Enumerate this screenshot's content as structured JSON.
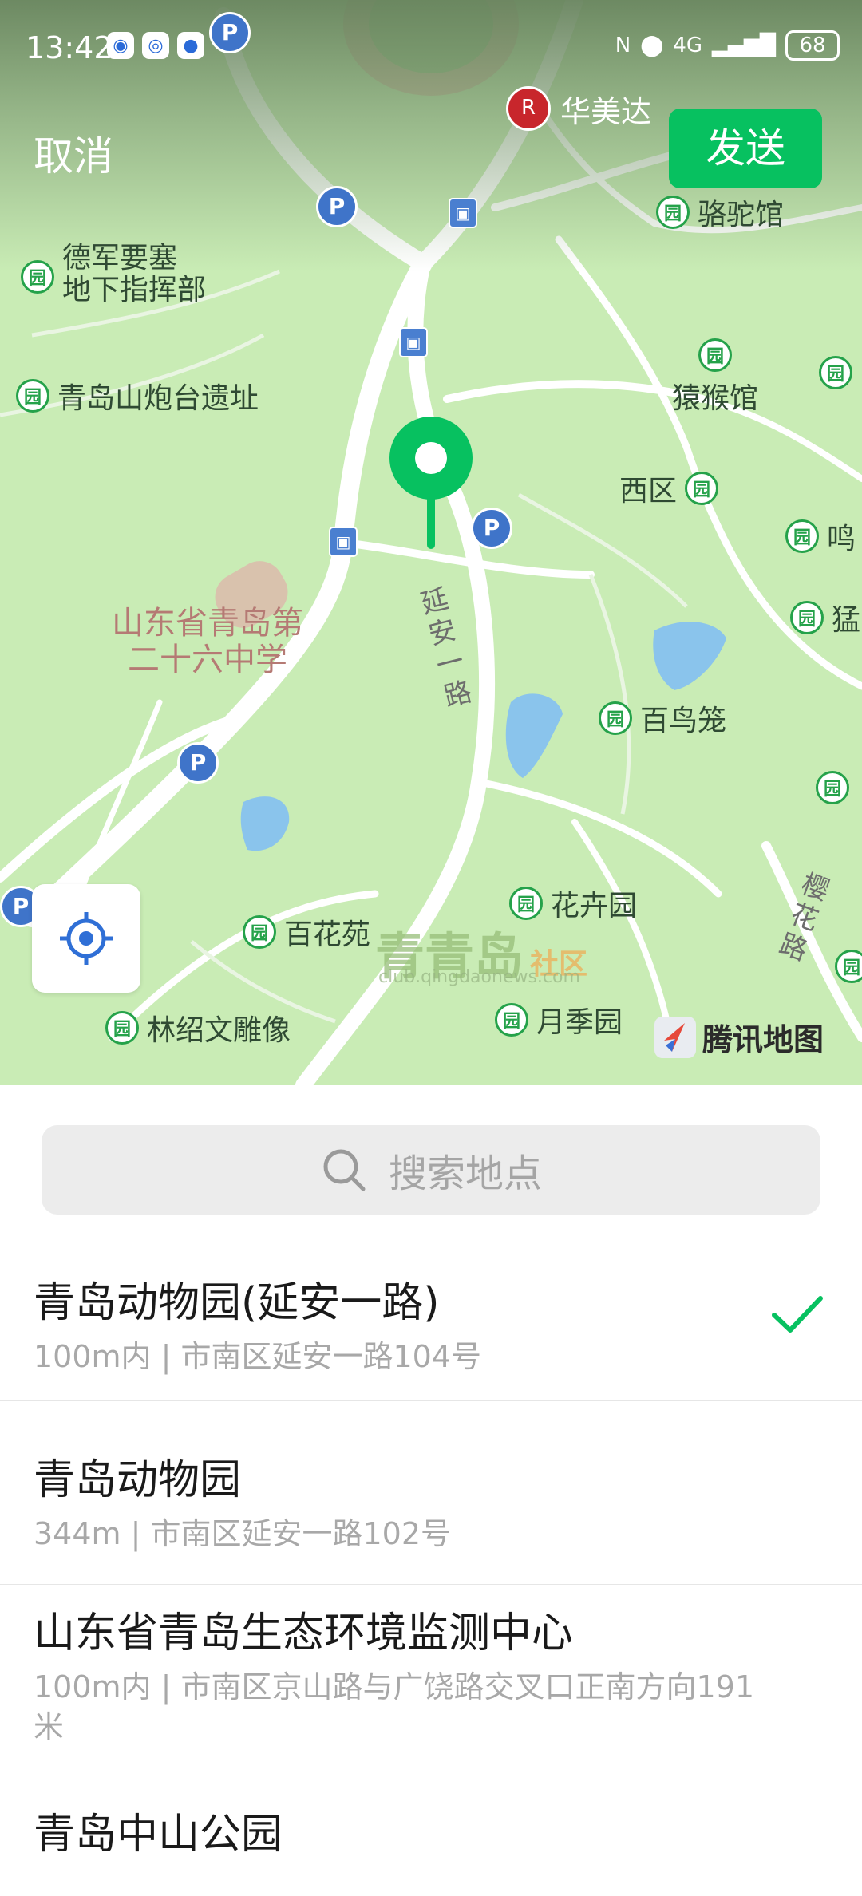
{
  "status": {
    "time": "13:42",
    "battery": "68",
    "network": "4G",
    "colors": {
      "send_button": "#07c160",
      "selected_check": "#07c160"
    }
  },
  "header": {
    "cancel_label": "取消",
    "send_label": "发送"
  },
  "map": {
    "hotel": "华美达",
    "pois": [
      {
        "label": "骆驼馆"
      },
      {
        "label": "德军要塞\n地下指挥部"
      },
      {
        "label": "青岛山炮台遗址"
      },
      {
        "label": "猿猴馆"
      },
      {
        "label": "西区"
      },
      {
        "label": "鸣"
      },
      {
        "label": "猛"
      },
      {
        "label": "百鸟笼"
      },
      {
        "label": "花卉园"
      },
      {
        "label": "百花苑"
      },
      {
        "label": "月季园"
      },
      {
        "label": "林绍文雕像"
      }
    ],
    "school": "山东省青岛第\n二十六中学",
    "roads": [
      "延安一路",
      "樱花路"
    ],
    "watermark": "青青岛",
    "watermark_sub": "社区",
    "watermark_url": "club.qingdaonews.com",
    "provider": "腾讯地图"
  },
  "search": {
    "placeholder": "搜索地点"
  },
  "results": [
    {
      "title": "青岛动物园(延安一路)",
      "subtitle": "100m内 | 市南区延安一路104号",
      "selected": true
    },
    {
      "title": "青岛动物园",
      "subtitle": "344m | 市南区延安一路102号",
      "selected": false
    },
    {
      "title": "山东省青岛生态环境监测中心",
      "subtitle": "100m内 | 市南区京山路与广饶路交叉口正南方向191米",
      "selected": false
    },
    {
      "title": "青岛中山公园",
      "subtitle": "",
      "selected": false
    }
  ]
}
